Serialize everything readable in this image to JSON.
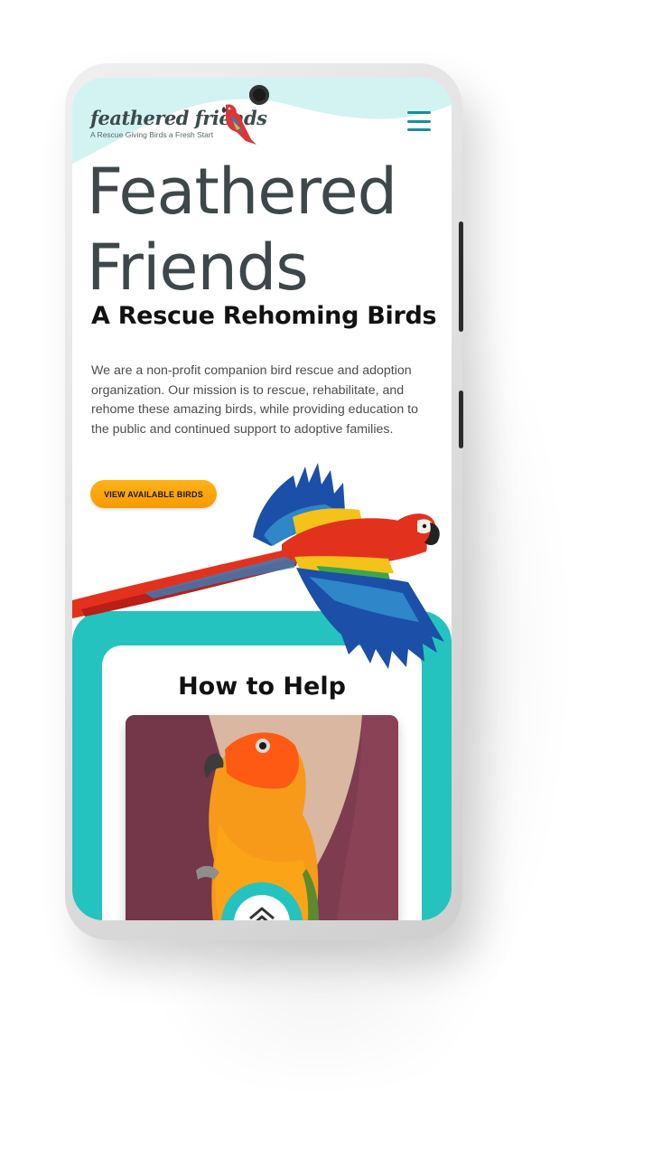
{
  "header": {
    "logo_name": "feathered friends",
    "logo_tagline": "A Rescue Giving Birds a Fresh Start",
    "menu_icon": "hamburger-menu-icon"
  },
  "hero": {
    "title": "Feathered Friends",
    "subtitle": "A Rescue Rehoming Birds",
    "body": "We are a non-profit companion bird rescue and adoption organization. Our mission is to rescue, rehabilitate, and rehome these amazing birds, while providing education to the public and continued support to adoptive families.",
    "cta_label": "VIEW AVAILABLE BIRDS"
  },
  "help": {
    "title": "How to Help"
  },
  "nav": {
    "home_icon": "home-icon"
  },
  "colors": {
    "teal": "#25c3bf",
    "light_teal": "#d3f3f3",
    "cta_orange": "#f9a30a",
    "title_gray": "#3e474a",
    "menu_teal": "#1e8d96"
  }
}
